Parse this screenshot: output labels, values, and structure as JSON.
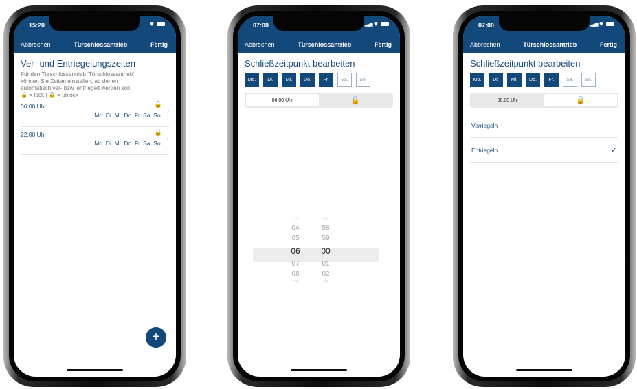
{
  "phone1": {
    "status_time": "15:20",
    "nav": {
      "cancel": "Abbrechen",
      "title": "Türschlossantrieb",
      "done": "Fertig"
    },
    "page_title": "Ver- und Entriegelungszeiten",
    "desc_line1": "Für den Türschlossantrieb 'Türschlossantrieb'",
    "desc_line2": "können Sie Zeiten einstellen, ab denen",
    "desc_line3": "automatisch ver- bzw. entriegelt werden soll.",
    "desc_line4": "🔒 = lock | 🔓 = unlock",
    "rows": [
      {
        "time": "06:00 Uhr",
        "lock": "🔓",
        "days": "Mo. Di. Mi. Do. Fr. Sa. So."
      },
      {
        "time": "22:00 Uhr",
        "lock": "🔒",
        "days": "Mo. Di. Mi. Do. Fr. Sa. So."
      }
    ],
    "fab": "+"
  },
  "phone2": {
    "status_time": "07:00",
    "nav": {
      "cancel": "Abbrechen",
      "title": "Türschlossantrieb",
      "done": "Fertig"
    },
    "page_title": "Schließzeitpunkt bearbeiten",
    "days": [
      "Mo.",
      "Di.",
      "Mi.",
      "Do.",
      "Fr.",
      "Sa.",
      "So."
    ],
    "seg_time": "06:00 Uhr",
    "seg_icon": "🔓",
    "hours": [
      "03",
      "04",
      "05",
      "06",
      "07",
      "08",
      "09"
    ],
    "minutes": [
      "57",
      "58",
      "59",
      "00",
      "01",
      "02",
      "03"
    ]
  },
  "phone3": {
    "status_time": "07:00",
    "nav": {
      "cancel": "Abbrechen",
      "title": "Türschlossantrieb",
      "done": "Fertig"
    },
    "page_title": "Schließzeitpunkt bearbeiten",
    "days": [
      "Mo.",
      "Di.",
      "Mi.",
      "Do.",
      "Fr.",
      "Sa.",
      "So."
    ],
    "seg_time": "06:00 Uhr",
    "seg_icon": "🔓",
    "option_lock": "Verriegeln",
    "option_unlock": "Entriegeln",
    "check": "✓"
  },
  "colors": {
    "primary": "#13487a",
    "text_primary": "#1a4d7c"
  }
}
